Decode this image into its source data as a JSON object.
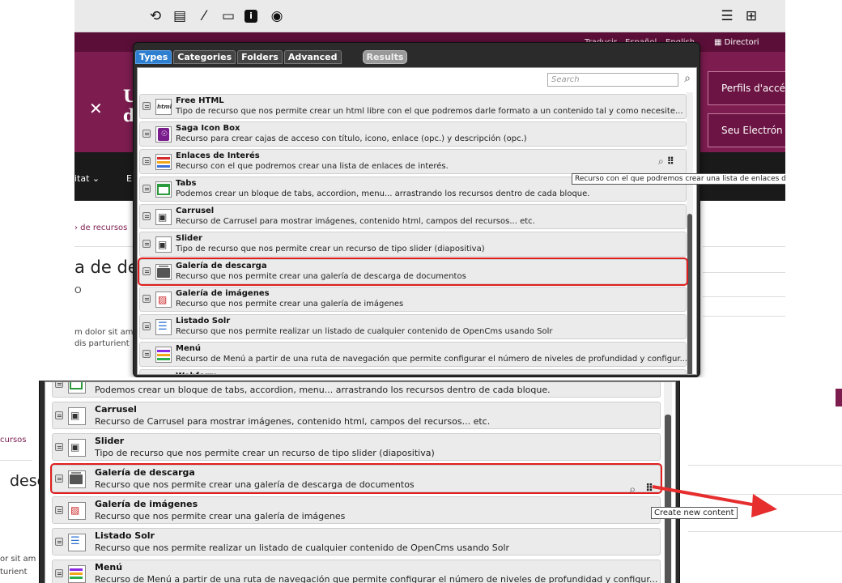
{
  "toolbar": {
    "left_icons": [
      "history-icon",
      "clipboard-icon",
      "wand-icon",
      "folder-icon",
      "info-icon",
      "circle-icon"
    ],
    "right_icons": [
      "list-icon",
      "sitemap-icon"
    ]
  },
  "site": {
    "top_links": [
      "Traducir",
      "Español",
      "English"
    ],
    "directory": "Directori",
    "logo_line1": "Ur",
    "logo_line2": "de",
    "btn_profiles": "Perfils d'accé",
    "btn_electronic": "Seu Electrón",
    "nav_item": "itat ⌄",
    "nav_item2": "E",
    "breadcrumb": "› de recursos",
    "breadcrumb_p2": "cursos",
    "page_title": "a de desc",
    "page_title_p2": "desc",
    "sub_o": "O",
    "lorem1": "m dolor sit am",
    "lorem2": "dis parturient",
    "lorem1_p2": "or sit am",
    "lorem2_p2": "turient"
  },
  "dialog": {
    "tabs": [
      "Types",
      "Categories",
      "Folders",
      "Advanced"
    ],
    "results_tab": "Results",
    "search_placeholder": "Search",
    "items": [
      {
        "title": "Free HTML",
        "desc": "Tipo de recurso que nos permite crear un html libre con el que podremos darle formato a un contenido tal y como necesite...",
        "icon": "html-icon"
      },
      {
        "title": "Saga Icon Box",
        "desc": "Recurso para crear cajas de acceso con título, icono, enlace (opc.) y descripción (opc.)",
        "icon": "icon-box-icon"
      },
      {
        "title": "Enlaces de Interés",
        "desc": "Recurso con el que podremos crear una lista de enlaces de interés.",
        "icon": "links-icon"
      },
      {
        "title": "Tabs",
        "desc": "Podemos crear un bloque de tabs, accordion, menu... arrastrando los recursos dentro de cada bloque.",
        "icon": "tabs-icon"
      },
      {
        "title": "Carrusel",
        "desc": "Recurso de Carrusel para mostrar imágenes, contenido html, campos del recursos... etc.",
        "icon": "carousel-icon"
      },
      {
        "title": "Slider",
        "desc": "Tipo de recurso que nos permite crear un recurso de tipo slider (diapositiva)",
        "icon": "slider-icon"
      },
      {
        "title": "Galería de descarga",
        "desc": "Recurso que nos permite crear una galería de descarga de documentos",
        "icon": "download-gallery-icon"
      },
      {
        "title": "Galería de imágenes",
        "desc": "Recurso que nos permite crear una galería de imágenes",
        "icon": "image-gallery-icon"
      },
      {
        "title": "Listado Solr",
        "desc": "Recurso que nos permite realizar un listado de cualquier contenido de OpenCms usando Solr",
        "icon": "list-icon"
      },
      {
        "title": "Menú",
        "desc": "Recurso de Menú a partir de una ruta de navegación que permite configurar el número de niveles de profundidad y configur...",
        "icon": "menu-icon"
      },
      {
        "title": "Webform",
        "desc": "",
        "icon": "form-icon"
      }
    ],
    "tooltip_enlaces": "Recurso con el que podremos crear una lista de enlaces de in",
    "p2_tabs_partial": "Podemos crear un bloque de tabs, accordion, menu... arrastrando los recursos dentro de cada bloque.",
    "p2_menu_desc": "Recurso de Menú a partir de una ruta de navegación que permite configurar el número de niveles de profundidad y configur...",
    "tooltip_create": "Create new content"
  },
  "colors": {
    "accent": "#7c1c4f",
    "highlight": "#e01e1e",
    "tab_active": "#2e7fd0"
  }
}
